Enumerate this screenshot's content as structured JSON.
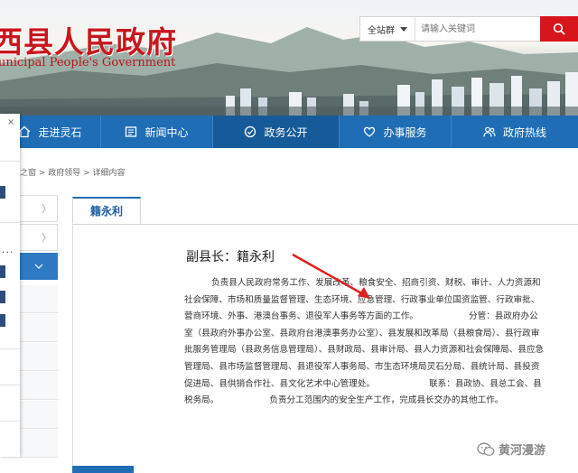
{
  "header": {
    "title": "西县人民政府",
    "subtitle": "unicipal People's Government",
    "search": {
      "scope": "全站群",
      "placeholder": "请输入关键词"
    }
  },
  "nav": {
    "items": [
      {
        "label": "走进灵石",
        "icon": "home-icon"
      },
      {
        "label": "新闻中心",
        "icon": "news-icon"
      },
      {
        "label": "政务公开",
        "icon": "check-circle-icon"
      },
      {
        "label": "办事服务",
        "icon": "heart-icon"
      },
      {
        "label": "政府热线",
        "icon": "people-icon"
      }
    ]
  },
  "float_panel": {
    "close": "×",
    "dots": "..."
  },
  "breadcrumb": "之窗 > 政府领导 > 详细内容",
  "sidebar": {
    "chevron": "〉"
  },
  "article": {
    "tab": "籍永利",
    "heading": "副县长：籍永利",
    "duties": "负责县人民政府常务工作、发展改革、粮食安全、招商引资、财税、审计、人力资源和社会保障、市场和质量监督管理、生态环境、应急管理、行政事业单位国资监管、行政审批、营商环境、外事、港澳台事务、退役军人事务等方面的工作。",
    "divisions": "分管：县政府办公室（县政府外事办公室、县政府台港澳事务办公室）、县发展和改革局（县粮食局）、县行政审批服务管理局（县政务信息管理局）、县财政局、县审计局、县人力资源和社会保障局、县应急管理局、县市场监督管理局、县退役军人事务局、市生态环境局灵石分局、县统计局、县投资促进局、县供销合作社、县文化艺术中心管理处。",
    "contacts": "联系：县政协、县总工会、县税务局。",
    "other": "负责分工范围内的安全生产工作，完成县长交办的其他工作。"
  },
  "watermark": "黄河漫游",
  "colors": {
    "nav_blue": "#1f6db5",
    "title_red": "#c8171d",
    "search_red": "#d7151c",
    "arrow_red": "#e0201c"
  }
}
